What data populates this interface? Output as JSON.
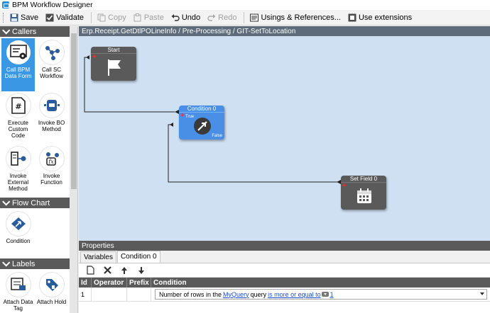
{
  "window": {
    "title": "BPM Workflow Designer"
  },
  "toolbar": {
    "save": "Save",
    "validate": "Validate",
    "copy": "Copy",
    "paste": "Paste",
    "undo": "Undo",
    "redo": "Redo",
    "usings": "Usings & References...",
    "use_extensions": "Use extensions"
  },
  "palette": {
    "callers": {
      "title": "Callers",
      "items": [
        {
          "label": "Call BPM Data Form",
          "icon": "form-icon",
          "selected": true
        },
        {
          "label": "Call SC Workflow",
          "icon": "network-icon"
        },
        {
          "label": "Execute Custom Code",
          "icon": "code-icon"
        },
        {
          "label": "Invoke BO Method",
          "icon": "bo-method-icon"
        },
        {
          "label": "Invoke External Method",
          "icon": "external-method-icon"
        },
        {
          "label": "Invoke Function",
          "icon": "function-icon"
        }
      ]
    },
    "flow_chart": {
      "title": "Flow Chart",
      "items": [
        {
          "label": "Condition",
          "icon": "condition-icon"
        }
      ]
    },
    "labels": {
      "title": "Labels",
      "items": [
        {
          "label": "Attach Data Tag",
          "icon": "data-tag-icon"
        },
        {
          "label": "Attach Hold",
          "icon": "hold-icon"
        }
      ]
    }
  },
  "canvas": {
    "breadcrumb": "Erp.Receipt.GetDtlPOLineInfo / Pre-Processing / GIT-SetToLocation",
    "nodes": {
      "start": {
        "title": "Start"
      },
      "condition": {
        "title": "Condition 0",
        "true_label": "True",
        "false_label": "False"
      },
      "set_field": {
        "title": "Set Field 0"
      }
    }
  },
  "properties": {
    "title": "Properties",
    "tabs": [
      "Variables",
      "Condition 0"
    ],
    "active_tab": "Condition 0",
    "columns": [
      "Id",
      "Operator",
      "Prefix",
      "Condition"
    ],
    "rows": [
      {
        "id": "1",
        "operator": "",
        "prefix": "",
        "condition": {
          "text1": "Number of rows in the",
          "link1": "MyQuery",
          "text2": "query",
          "link2": "is more or equal to",
          "link3": "1"
        }
      }
    ]
  },
  "colors": {
    "canvas_bg": "#cfe0f3",
    "node_bg": "#5a5a5a",
    "node_active": "#4a8fe6",
    "selected_palette": "#3a97e3",
    "link": "#1a4fd6"
  }
}
